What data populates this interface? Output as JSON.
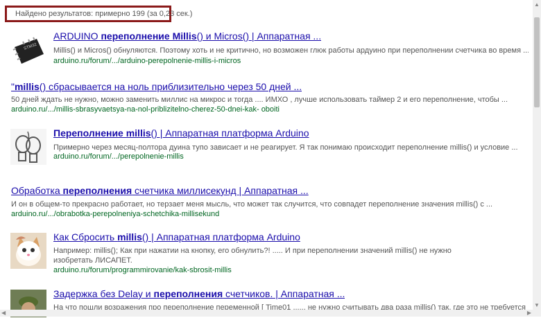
{
  "stats": {
    "text": "Найдено результатов: примерно 199 (за 0,23 сек.)"
  },
  "results": [
    {
      "title_parts": [
        "ARDUINO ",
        "переполнение Millis",
        "() и Micros() | Аппаратная ..."
      ],
      "snippet": "Millis() и Micros() обнуляются. Поэтому хоть и не критично, но возможен глюк работы ардуино при переполнении счетчика во время ...",
      "url": "arduino.ru/forum/.../arduino-perepolnenie-millis-i-micros",
      "thumb": "chip-image"
    },
    {
      "title_parts": [
        "\"",
        "millis",
        "() сбрасывается на ноль приблизительно через 50 дней ..."
      ],
      "snippet": "50 дней ждать не нужно, можно заменить миллис на микрос и тогда .... ИМХО , лучше использовать таймер 2 и его переполнение, чтобы ...",
      "url": "arduino.ru/.../millis-sbrasyvaetsya-na-nol-priblizitelno-cherez-50-dnei-kak- oboiti",
      "thumb": ""
    },
    {
      "title_parts": [
        "Переполнение millis",
        "() | Аппаратная платформа Arduino",
        ""
      ],
      "snippet": "Примерно через месяц-полтора дуина тупо зависает и не реагирует. Я так понимаю происходит переполнение millis() и условие ...",
      "url": "arduino.ru/forum/.../perepolnenie-millis",
      "thumb": "boxing-gloves-image"
    },
    {
      "title_parts": [
        "Обработка ",
        "переполнения",
        " счетчика миллисекунд | Аппаратная ..."
      ],
      "snippet": "И он в общем-то прекрасно работает, но терзает меня мысль, что может так случится, что совпадет переполнение значения millis() с ...",
      "url": "arduino.ru/.../obrabotka-perepolneniya-schetchika-millisekund",
      "thumb": ""
    },
    {
      "title_parts": [
        "Как Сбросить ",
        "millis",
        "() | Аппаратная платформа Arduino"
      ],
      "snippet": "Например: millis(); Как при нажатии на кнопку, его обнулить?! ..... И при переполнении значений millis() не нужно изобретать ЛИСАПЕТ.",
      "url": "arduino.ru/forum/programmirovanie/kak-sbrosit-millis",
      "thumb": "cat-image"
    },
    {
      "title_parts": [
        "Задержка без Delay и ",
        "переполнения",
        " счетчиков. | Аппаратная ..."
      ],
      "snippet": "На что пошли возражения про переполнение переменной [ Time01 ...... не нужно считывать два раза millis() так, где это не требуется",
      "url": "",
      "thumb": "person-image"
    }
  ]
}
